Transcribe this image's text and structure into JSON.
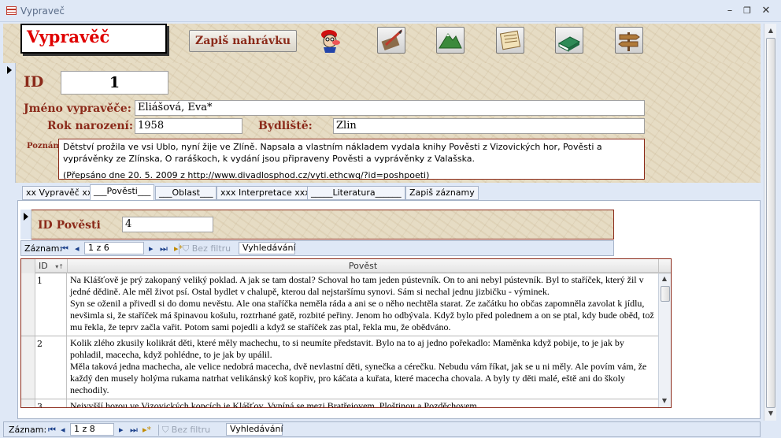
{
  "window": {
    "title": "Vypraveč",
    "minimize": "–",
    "restore": "❐",
    "close": "✕"
  },
  "header": {
    "form_title": "Vypravěč",
    "record_button": "Zapiš nahrávku",
    "icon_buttons": [
      "character-icon",
      "quill-icon",
      "mountain-icon",
      "scroll-icon",
      "book-icon",
      "signpost-icon"
    ]
  },
  "record": {
    "id_label": "ID",
    "id_value": "1",
    "name_label": "Jméno vypravěče:",
    "name_value": "Eliášová, Eva*",
    "birth_label": "Rok narození:",
    "birth_value": "1958",
    "residence_label": "Bydliště:",
    "residence_value": "Zlin",
    "notes_label": "Poznámky",
    "notes_value": "Dětství prožila ve vsi Ublo, nyní žije ve Zlíně. Napsala a vlastním nákladem vydala knihy Pověsti z Vizovických hor, Pověsti a vyprávěnky ze Zlínska, O raráškoch, k vydání jsou připraveny Pověsti a vyprávěnky z Valašska.",
    "notes_cut_line": "(Přepsáno dne 20. 5. 2009 z http://www.divadlosphod.cz/vyti.ethcwq/?id=poshpoeti)"
  },
  "tabs": [
    "xx Vypravěč xx",
    "___Pověsti___",
    "___Oblast___",
    "xxx Interpretace xxx",
    "_____Literatura______",
    "Zapiš záznamy"
  ],
  "active_tab": 1,
  "subform": {
    "id_label": "ID Pověsti",
    "id_value": "4"
  },
  "sub_nav": {
    "record_label": "Záznam:",
    "position": "1 z 6",
    "filter": "Bez filtru",
    "search": "Vyhledávání"
  },
  "grid": {
    "col_id": "ID",
    "col_text": "Pověst",
    "rows": [
      {
        "id": "1",
        "text": "Na Klášťově je prý zakopaný veliký poklad. A jak se tam dostal? Schoval ho tam jeden pústevník. On to ani nebyl pústevník. Byl to staříček, který žil v jedné dědině. Ale měl život psí. Ostal bydlet v chalupě, kterou dal nejstaršímu synovi. Sám si nechal jednu jizbičku - výminek.\nSyn se oženil a přivedl si do domu nevěstu. Ale ona staříčka neměla ráda a ani se o něho nechtěla starat. Ze začátku ho občas zapomněla zavolat k jídlu, nevšimla si, že staříček má špinavou košulu, roztrhané gatě, rozbité peřiny. Jenom ho odbývala. Když bylo před polednem a on se ptal, kdy bude oběd, tož mu řekla, že teprv začla vařit. Potom sami pojedli a když se staříček zas ptal, řekla mu, že obědváno."
      },
      {
        "id": "2",
        "text": "Kolik zlého zkusily kolikrát děti, které měly machechu, to si neumíte představit. Bylo na to aj jedno pořekadlo: Maměnka když pobije, to je jak by pohladil, macecha, když pohlédne, to je jak by upálil.\nMěla taková jedna machecha, ale velice nedobrá macecha, dvě nevlastní děti, synečka a cérečku. Nebudu vám říkat, jak se u ni měly. Ale povím vám, že každý den musely holýma rukama natrhat velikánský koš kopřiv, pro káčata a kuřata, které macecha chovala. A byly ty děti malé, eště ani do školy nechodily."
      },
      {
        "id": "3",
        "text": "Nejvyšší horou ve Vizovických kopcích je Klášťov. Vypíná se mezi Bratřejovem, Ploštinou a Pozděchovem."
      }
    ]
  },
  "main_nav": {
    "record_label": "Záznam:",
    "position": "1 z 8",
    "filter": "Bez filtru",
    "search": "Vyhledávání"
  }
}
